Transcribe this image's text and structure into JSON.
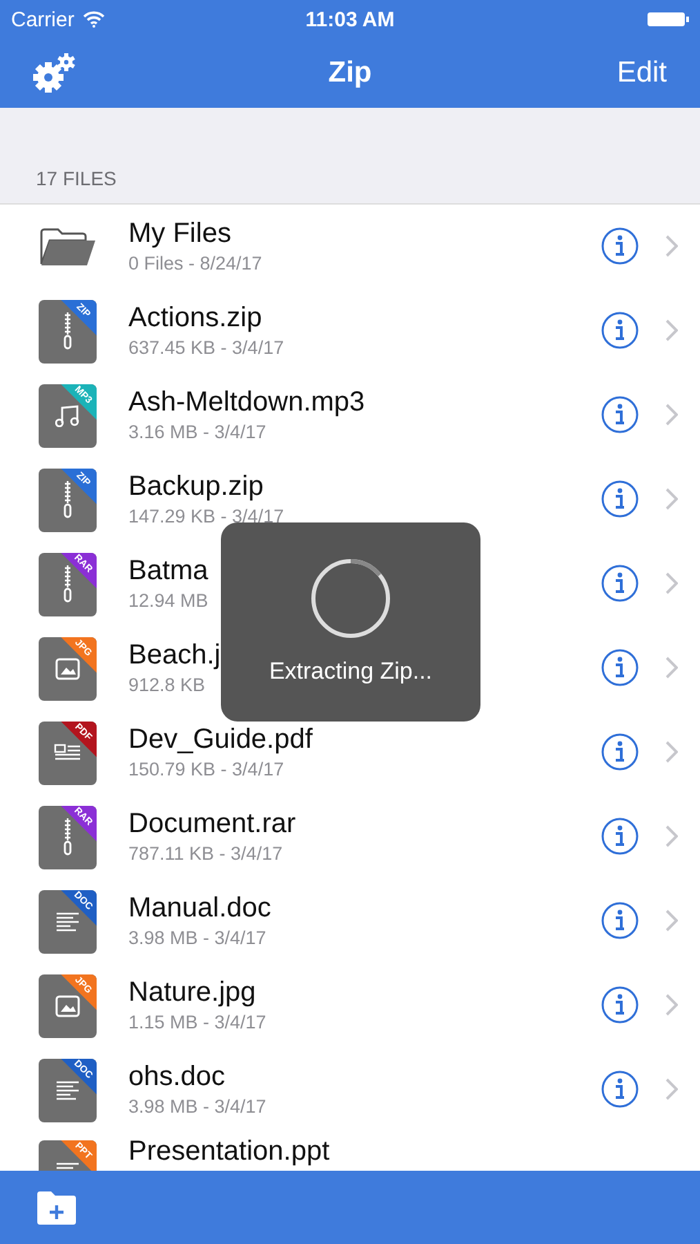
{
  "status_bar": {
    "carrier": "Carrier",
    "time": "11:03 AM"
  },
  "nav": {
    "title": "Zip",
    "edit": "Edit"
  },
  "section": "17 FILES",
  "files": [
    {
      "kind": "folder",
      "name": "My Files",
      "detail": "0 Files - 8/24/17"
    },
    {
      "kind": "archive",
      "name": "Actions.zip",
      "detail": "637.45 KB - 3/4/17",
      "badge": "ZIP",
      "color": "#2a6fd6"
    },
    {
      "kind": "audio",
      "name": "Ash-Meltdown.mp3",
      "detail": "3.16 MB - 3/4/17",
      "badge": "MP3",
      "color": "#1bb3b8"
    },
    {
      "kind": "archive",
      "name": "Backup.zip",
      "detail": "147.29 KB - 3/4/17",
      "badge": "ZIP",
      "color": "#2a6fd6"
    },
    {
      "kind": "archive",
      "name": "Batma",
      "detail": "12.94 MB",
      "badge": "RAR",
      "color": "#8b2fd6"
    },
    {
      "kind": "image",
      "name": "Beach.j",
      "detail": "912.8 KB",
      "badge": "JPG",
      "color": "#f2741f"
    },
    {
      "kind": "pdf",
      "name": "Dev_Guide.pdf",
      "detail": "150.79 KB - 3/4/17",
      "badge": "PDF",
      "color": "#b3141e"
    },
    {
      "kind": "archive",
      "name": "Document.rar",
      "detail": "787.11 KB - 3/4/17",
      "badge": "RAR",
      "color": "#8b2fd6"
    },
    {
      "kind": "doc",
      "name": "Manual.doc",
      "detail": "3.98 MB - 3/4/17",
      "badge": "DOC",
      "color": "#1f5fc4"
    },
    {
      "kind": "image",
      "name": "Nature.jpg",
      "detail": "1.15 MB - 3/4/17",
      "badge": "JPG",
      "color": "#f2741f"
    },
    {
      "kind": "doc",
      "name": "ohs.doc",
      "detail": "3.98 MB - 3/4/17",
      "badge": "DOC",
      "color": "#1f5fc4"
    },
    {
      "kind": "doc",
      "name": "Presentation.ppt",
      "badge": "PPT",
      "color": "#f2741f"
    }
  ],
  "overlay": {
    "message": "Extracting Zip..."
  }
}
